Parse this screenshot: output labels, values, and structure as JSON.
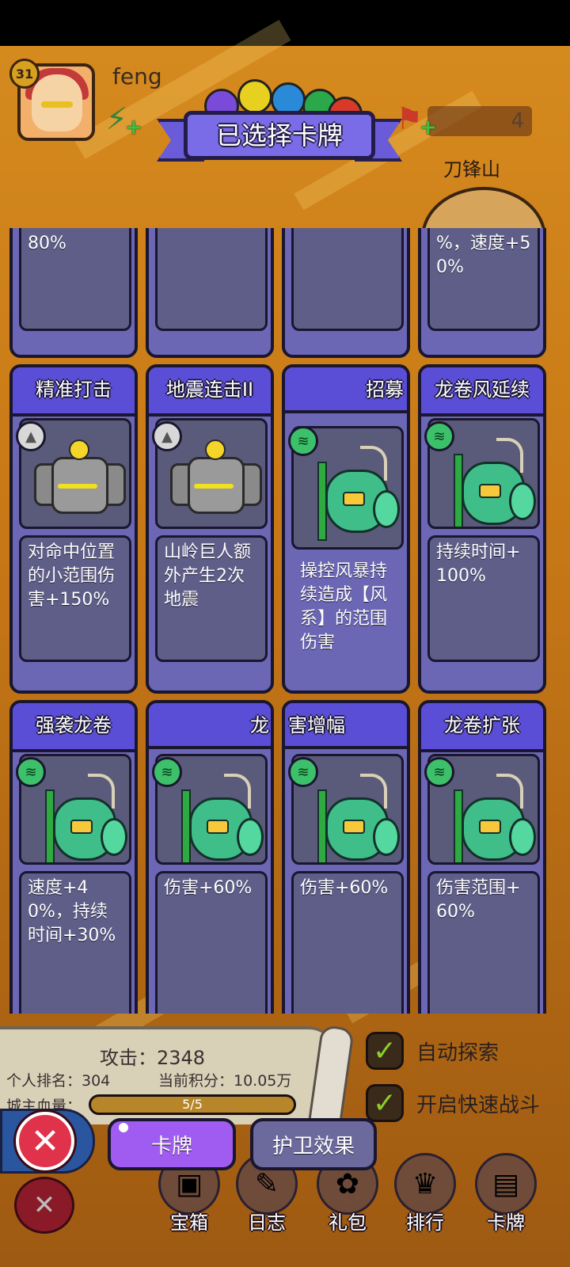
{
  "header": {
    "level": "31",
    "username": "feng",
    "flag_count": "4",
    "map_name": "刀锋山"
  },
  "banner": {
    "title": "已选择卡牌"
  },
  "orbs": [
    {
      "name": "purple-sword-orb",
      "color": "#7a4ad8"
    },
    {
      "name": "lightning-orb",
      "color": "#e8d020"
    },
    {
      "name": "ice-orb",
      "color": "#2a8ad8"
    },
    {
      "name": "wind-orb",
      "color": "#2aa84a"
    },
    {
      "name": "fire-orb",
      "color": "#d83a2a"
    }
  ],
  "cards": {
    "row0": [
      {
        "desc": "80%"
      },
      {
        "desc": ""
      },
      {
        "desc": ""
      },
      {
        "desc": "%，速度+50%"
      }
    ],
    "row1": [
      {
        "title": "精准打击",
        "desc": "对命中位置的小范围伤害+150%",
        "type": "rock-icon",
        "art": "golem"
      },
      {
        "title": "地震连击II",
        "desc": "山岭巨人额外产生2次地震",
        "type": "rock-icon",
        "art": "golem"
      },
      {
        "title": "招募",
        "desc": "操控风暴持续造成【风系】的范围伤害",
        "type": "wind-icon",
        "art": "bird"
      },
      {
        "title": "龙卷风延续",
        "desc": "持续时间+100%",
        "type": "wind-icon",
        "art": "bird"
      }
    ],
    "row2": [
      {
        "title": "强袭龙卷",
        "desc": "速度+40%，持续时间+30%",
        "type": "wind-icon",
        "art": "bird"
      },
      {
        "title": "龙",
        "desc": "伤害+60%",
        "type": "wind-icon",
        "art": "bird"
      },
      {
        "title": "害增幅",
        "desc": "伤害+60%",
        "type": "wind-icon",
        "art": "bird"
      },
      {
        "title": "龙卷扩张",
        "desc": "伤害范围+60%",
        "type": "wind-icon",
        "art": "bird"
      }
    ]
  },
  "stats": {
    "attack": "攻击：2348",
    "rank": "个人排名：304",
    "score": "当前积分：10.05万",
    "hp_label": "城主血量：",
    "hp_text": "5/5",
    "hp_fraction": 1.0
  },
  "toggles": [
    {
      "label": "自动探索",
      "checked": true
    },
    {
      "label": "开启快速战斗",
      "checked": true
    }
  ],
  "tabs": {
    "cards": "卡牌",
    "guard": "护卫效果"
  },
  "nav": [
    {
      "label": "宝箱",
      "icon": "chest-icon"
    },
    {
      "label": "日志",
      "icon": "scroll-icon"
    },
    {
      "label": "礼包",
      "icon": "gift-icon"
    },
    {
      "label": "排行",
      "icon": "trophy-icon"
    },
    {
      "label": "卡牌",
      "icon": "card-icon"
    }
  ]
}
